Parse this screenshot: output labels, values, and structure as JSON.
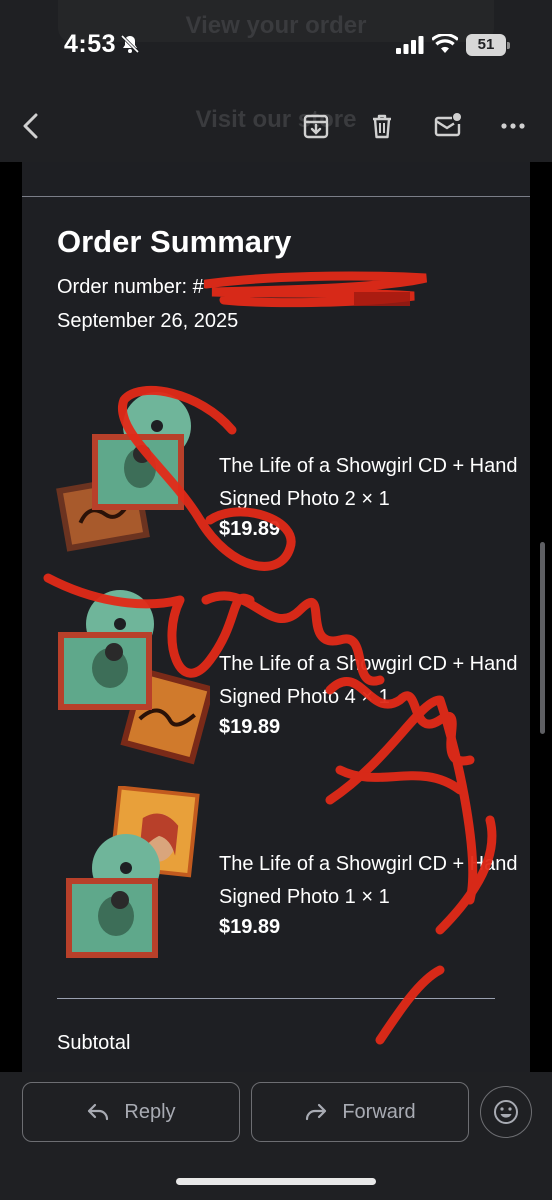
{
  "status_bar": {
    "time": "4:53",
    "battery": "51",
    "ghost_top": "View your order",
    "ghost_toolbar": "Visit our store"
  },
  "toolbar": {
    "icons": [
      "back-arrow-icon",
      "archive-icon",
      "trash-icon",
      "mark-unread-icon",
      "more-icon"
    ]
  },
  "order": {
    "title": "Order Summary",
    "number_label": "Order number: #",
    "date": "September 26, 2025",
    "items": [
      {
        "name": "The Life of a Showgirl CD + Hand Signed Photo 2 × 1",
        "price": "$19.89"
      },
      {
        "name": "The Life of a Showgirl CD + Hand Signed Photo 4 × 1",
        "price": "$19.89"
      },
      {
        "name": "The Life of a Showgirl CD + Hand Signed Photo 1 × 1",
        "price": "$19.89"
      }
    ],
    "subtotal_label": "Subtotal"
  },
  "actions": {
    "reply": "Reply",
    "forward": "Forward"
  },
  "colors": {
    "background": "#1f2023",
    "card": "#1e1f23",
    "scribble": "#e12a18",
    "accent_cd": "#6fb59a"
  }
}
